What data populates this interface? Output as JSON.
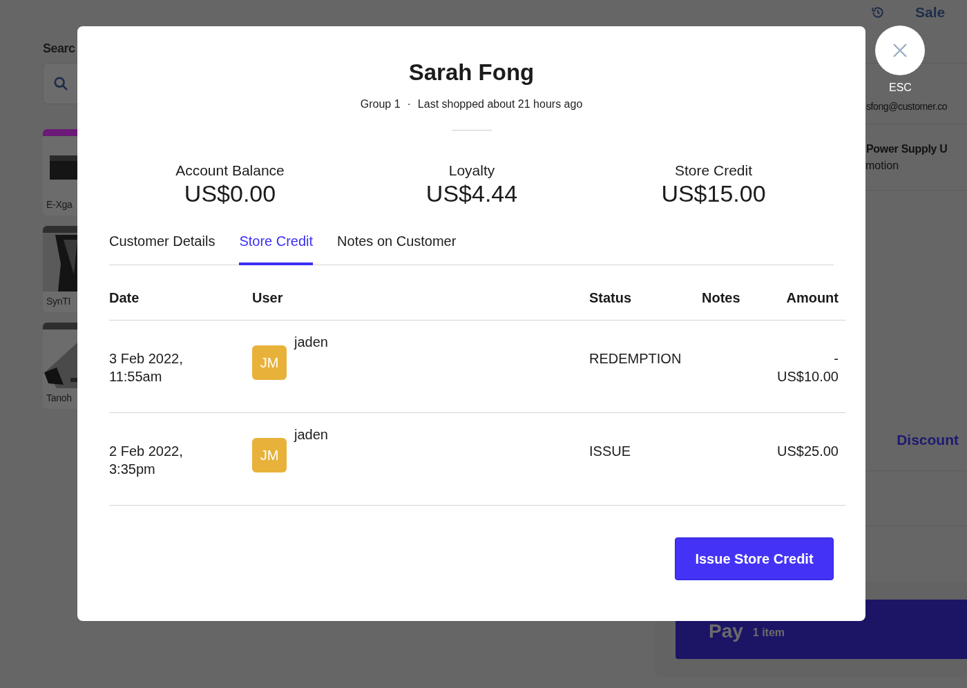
{
  "background": {
    "search_label": "Searc",
    "products": [
      {
        "name": "E-Xga",
        "color": "#6b1a78"
      },
      {
        "name": "SynTI",
        "color": "#2e2e2e"
      },
      {
        "name": "Tanoh",
        "color": "#2e2e2e"
      }
    ],
    "sale": {
      "title": "Sale",
      "customer_email": "sfong@customer.co",
      "line_item": {
        "name": "Power Supply U",
        "note": "motion"
      },
      "discount_label": "Discount",
      "pay": {
        "label": "Pay",
        "count": "1 item"
      }
    }
  },
  "modal": {
    "close_label": "ESC",
    "customer": {
      "name": "Sarah Fong",
      "group": "Group 1",
      "separator": "·",
      "last_shopped": "Last shopped about 21 hours ago"
    },
    "stats": [
      {
        "label": "Account Balance",
        "value": "US$0.00"
      },
      {
        "label": "Loyalty",
        "value": "US$4.44"
      },
      {
        "label": "Store Credit",
        "value": "US$15.00"
      }
    ],
    "tabs": [
      {
        "label": "Customer Details",
        "selected": false
      },
      {
        "label": "Store Credit",
        "selected": true
      },
      {
        "label": "Notes on Customer",
        "selected": false
      }
    ],
    "table": {
      "columns": [
        "Date",
        "User",
        "Status",
        "Notes",
        "Amount"
      ],
      "rows": [
        {
          "date": "3 Feb 2022, 11:55am",
          "initials": "JM",
          "user": "jaden",
          "status": "REDEMPTION",
          "amount": "- US$10.00"
        },
        {
          "date": "2 Feb 2022, 3:35pm",
          "initials": "JM",
          "user": "jaden",
          "status": "ISSUE",
          "amount": "US$25.00"
        }
      ]
    },
    "action": "Issue Store Credit"
  }
}
